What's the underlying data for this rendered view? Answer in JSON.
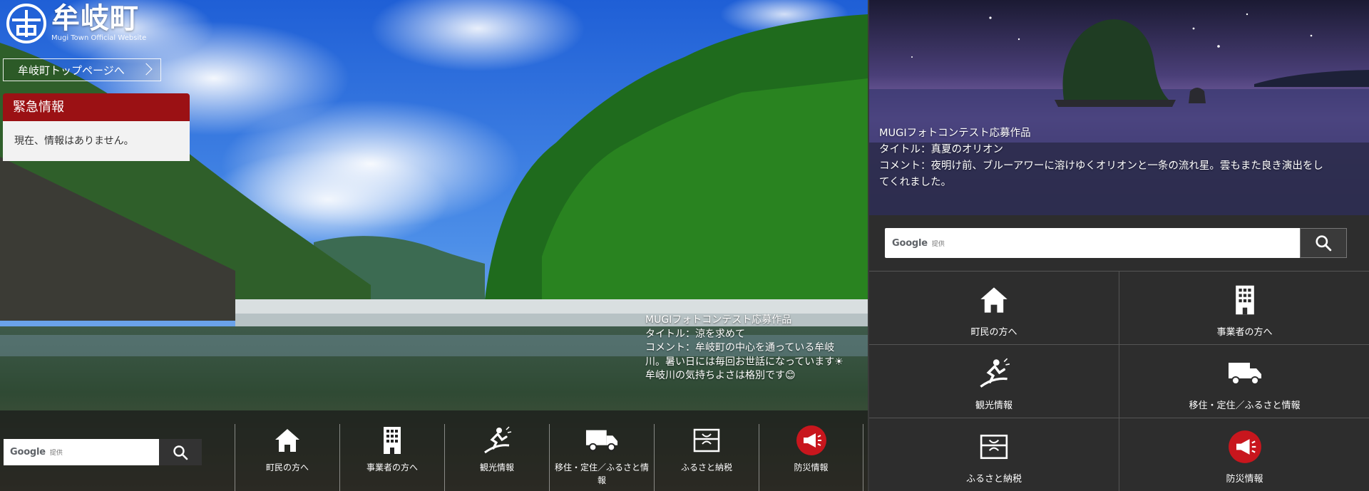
{
  "site": {
    "name": "牟岐町",
    "subtitle": "Mugi Town Official Website",
    "top_link": "牟岐町トップページへ"
  },
  "emergency": {
    "title": "緊急情報",
    "message": "現在、情報はありません。"
  },
  "hero_left_caption": [
    "MUGIフォトコンテスト応募作品",
    "タイトル：涼を求めて",
    "コメント：牟岐町の中心を通っている牟岐",
    "川。暑い日には毎回お世話になっています☀",
    "牟岐川の気持ちよさは格別です😊"
  ],
  "hero_right_caption": [
    "MUGIフォトコンテスト応募作品",
    "タイトル：真夏のオリオン",
    "コメント：夜明け前、ブルーアワーに溶けゆくオリオンと一条の流れ星。雲もまた良き演出をし",
    "てくれました。"
  ],
  "search": {
    "brand": "Google",
    "provided": "提供"
  },
  "nav": [
    {
      "label": "町民の方へ",
      "icon": "house-icon"
    },
    {
      "label": "事業者の方へ",
      "icon": "building-icon"
    },
    {
      "label": "観光情報",
      "icon": "surfer-icon"
    },
    {
      "label": "移住・定住／ふるさと情報",
      "icon": "truck-icon"
    },
    {
      "label": "ふるさと納税",
      "icon": "gift-box-icon"
    },
    {
      "label": "防災情報",
      "icon": "megaphone-icon"
    }
  ],
  "colors": {
    "emergency_red": "#9b1114",
    "dark_panel": "#2d2d2d",
    "disaster_red": "#c8161d"
  }
}
